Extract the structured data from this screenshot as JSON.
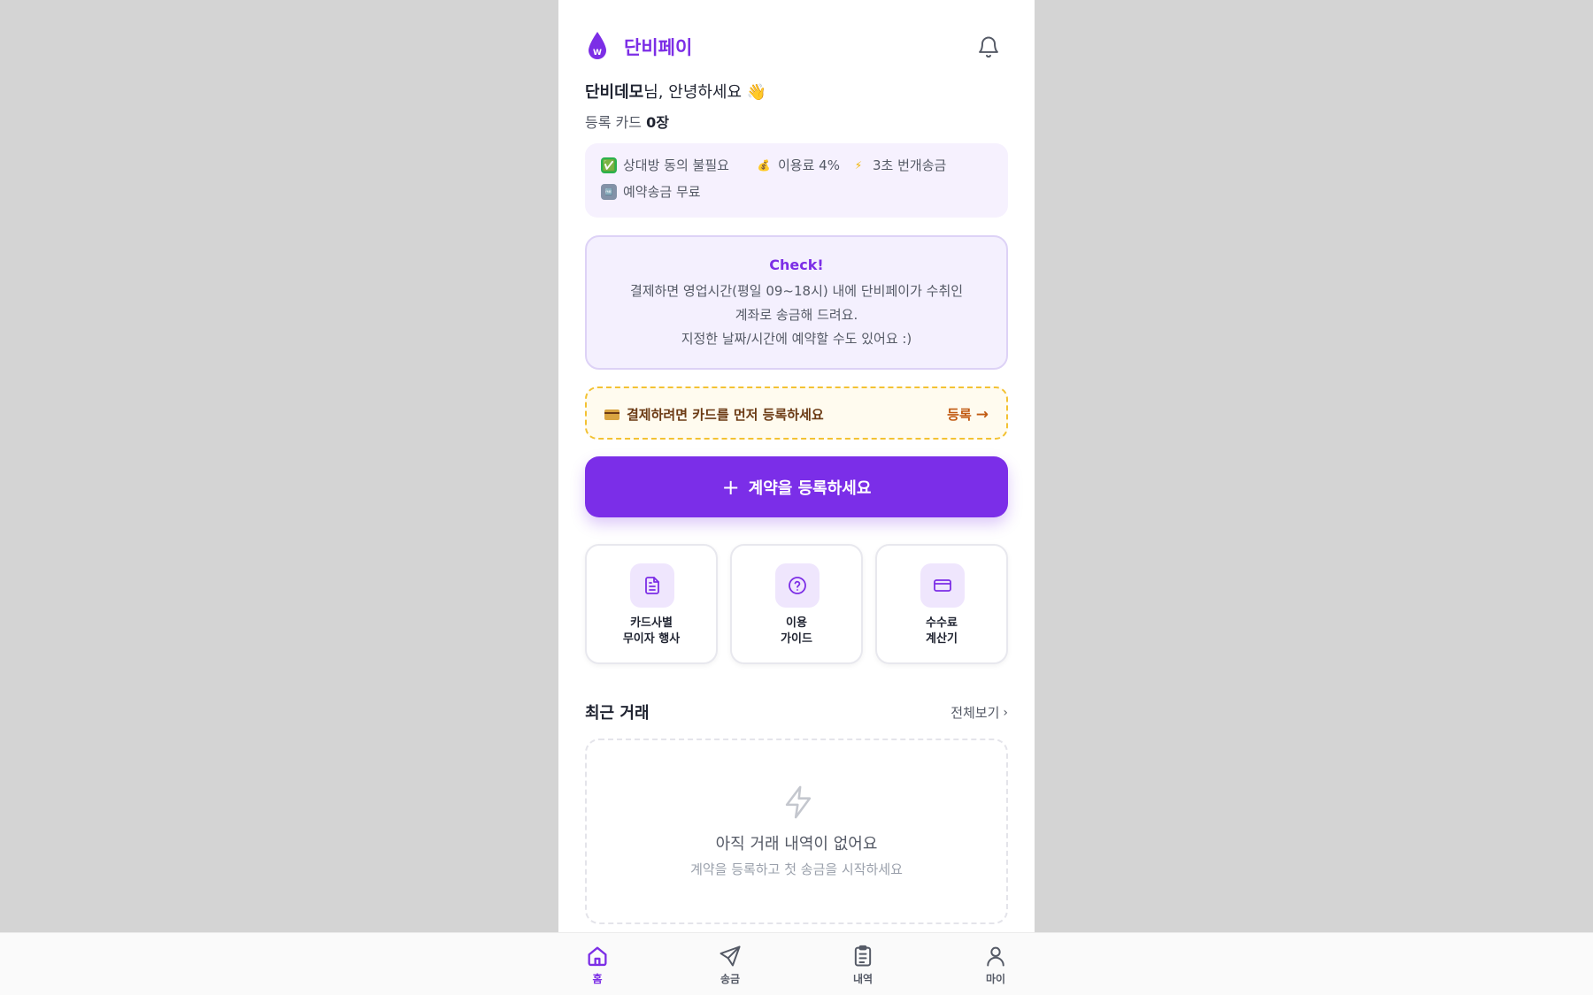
{
  "app": {
    "brand": "단비페이"
  },
  "greeting": {
    "name": "단비데모",
    "suffix": "님, 안녕하세요",
    "emoji": "👋"
  },
  "cards": {
    "label": "등록 카드",
    "count": "0장"
  },
  "features": [
    {
      "emoji": "✅",
      "icon": "check-mark-icon",
      "text": "상대방 동의 불필요"
    },
    {
      "emoji": "💰",
      "icon": "money-bag-icon",
      "text": "이용료 4%"
    },
    {
      "emoji": "⚡",
      "icon": "lightning-icon",
      "text": "3초 번개송금"
    },
    {
      "emoji": "🆓",
      "icon": "free-icon",
      "text": "예약송금 무료"
    }
  ],
  "check": {
    "title": "Check!",
    "lines": [
      "결제하면 영업시간(평일 09~18시) 내에 단비페이가 수취인",
      "계좌로 송금해 드려요.",
      "지정한 날짜/시간에 예약할 수도 있어요 :)"
    ]
  },
  "warning": {
    "text": "결제하려면 카드를 먼저 등록하세요",
    "link": "등록",
    "arrow": "→"
  },
  "main_button": {
    "icon": "+",
    "label": "계약을 등록하세요"
  },
  "tiles": [
    {
      "line1": "카드사별",
      "line2": "무이자 행사",
      "icon": "document-icon"
    },
    {
      "line1": "이용",
      "line2": "가이드",
      "icon": "question-circle-icon"
    },
    {
      "line1": "수수료",
      "line2": "계산기",
      "icon": "credit-card-icon"
    }
  ],
  "recent": {
    "title": "최근 거래",
    "see_all": "전체보기",
    "chevron": "›",
    "empty_title": "아직 거래 내역이 없어요",
    "empty_sub": "계약을 등록하고 첫 송금을 시작하세요"
  },
  "nav": [
    {
      "label": "홈",
      "icon": "home-icon",
      "active": true
    },
    {
      "label": "송금",
      "icon": "send-icon",
      "active": false
    },
    {
      "label": "내역",
      "icon": "clipboard-icon",
      "active": false
    },
    {
      "label": "마이",
      "icon": "user-icon",
      "active": false
    }
  ],
  "colors": {
    "accent": "#7c2ee6",
    "button": "#7b2ee8",
    "warning_border": "#f3c233",
    "background": "#d4d4d4"
  }
}
